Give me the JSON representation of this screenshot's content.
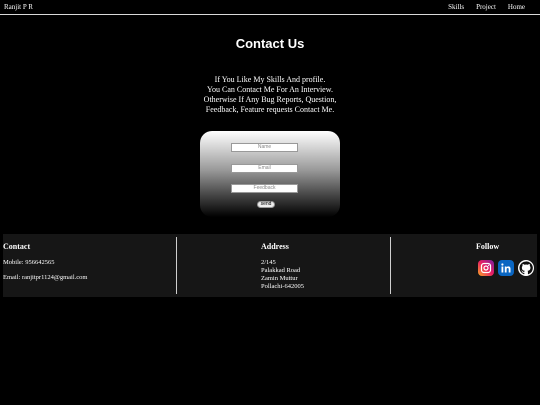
{
  "nav": {
    "brand": "Ranjit P R",
    "links": [
      "Skills",
      "Project",
      "Home"
    ]
  },
  "page": {
    "title": "Contact Us",
    "intro": [
      "If You Like My Skills And profile.",
      "You Can Contact Me For An Interview.",
      "Otherwise If Any Bug Reports, Question,",
      "Feedback, Feature requests Contact Me."
    ]
  },
  "form": {
    "name_placeholder": "Name",
    "email_placeholder": "Email",
    "feedback_placeholder": "Feedback",
    "send_label": "send"
  },
  "footer": {
    "contact": {
      "title": "Contact",
      "mobile": "Mobile: 956642565",
      "email": "Email: ranjitpr1124@gmail.com"
    },
    "address": {
      "title": "Address",
      "lines": [
        "2/145",
        "Palakkad Road",
        "Zamin Muttur",
        "Pollachi-642005"
      ]
    },
    "follow": {
      "title": "Follow",
      "icons": [
        "instagram-icon",
        "linkedin-icon",
        "github-icon"
      ]
    }
  }
}
